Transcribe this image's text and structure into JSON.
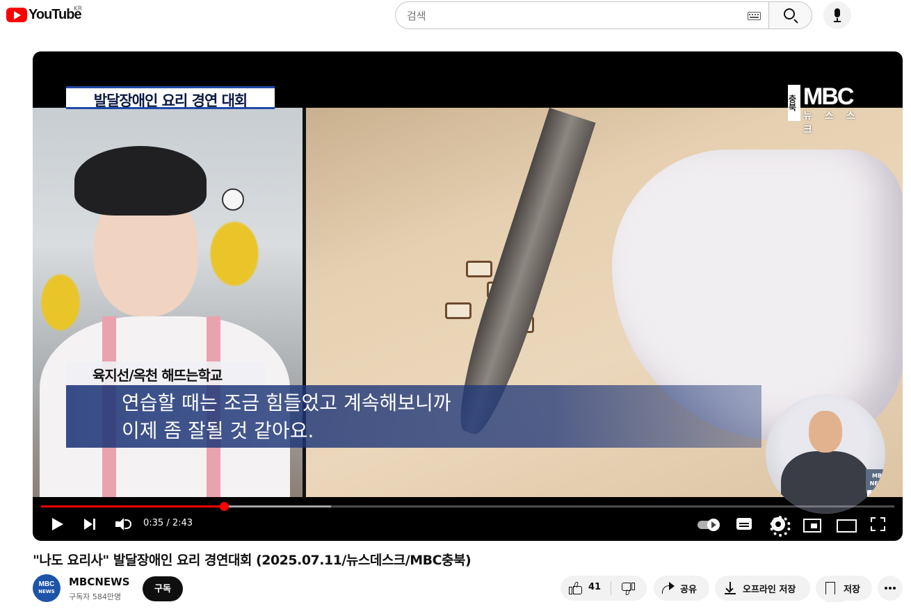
{
  "header": {
    "logo_text": "YouTube",
    "country_code": "KR",
    "search_placeholder": "검색"
  },
  "player": {
    "overlay_title": "발달장애인 요리 경연 대회",
    "broadcaster_logo": "MBC",
    "broadcaster_region": "충북",
    "broadcaster_sub": "뉴스",
    "broadcaster_sub2": "스크",
    "name_caption": "육지선/옥천 해뜨는학교",
    "subtitle_line1": "연습할 때는 조금 힘들었고 계속해보니까",
    "subtitle_line2": "이제 좀 잘될 것 같아요.",
    "interpreter_badge_line1": "MBC",
    "interpreter_badge_line2": "NEWS",
    "interpreter_tag": "구독",
    "time_current": "0:35",
    "time_total": "2:43",
    "time_display": "0:35 / 2:43",
    "progress_fraction": 0.2147,
    "buffer_fraction": 0.34
  },
  "video": {
    "title": "\"나도 요리사\" 발달장애인 요리 경연대회 (2025.07.11/뉴스데스크/MBC충북)"
  },
  "channel": {
    "name": "MBCNEWS",
    "subscribers": "구독자 584만명",
    "avatar_line1": "MBC",
    "avatar_line2": "NEWS",
    "subscribe_label": "구독"
  },
  "actions": {
    "like_count": "41",
    "share_label": "공유",
    "download_label": "오프라인 저장",
    "save_label": "저장"
  },
  "colors": {
    "brand_red": "#ff0000",
    "subscribe_bg": "#0f0f0f",
    "pill_bg": "#f2f2f2"
  }
}
